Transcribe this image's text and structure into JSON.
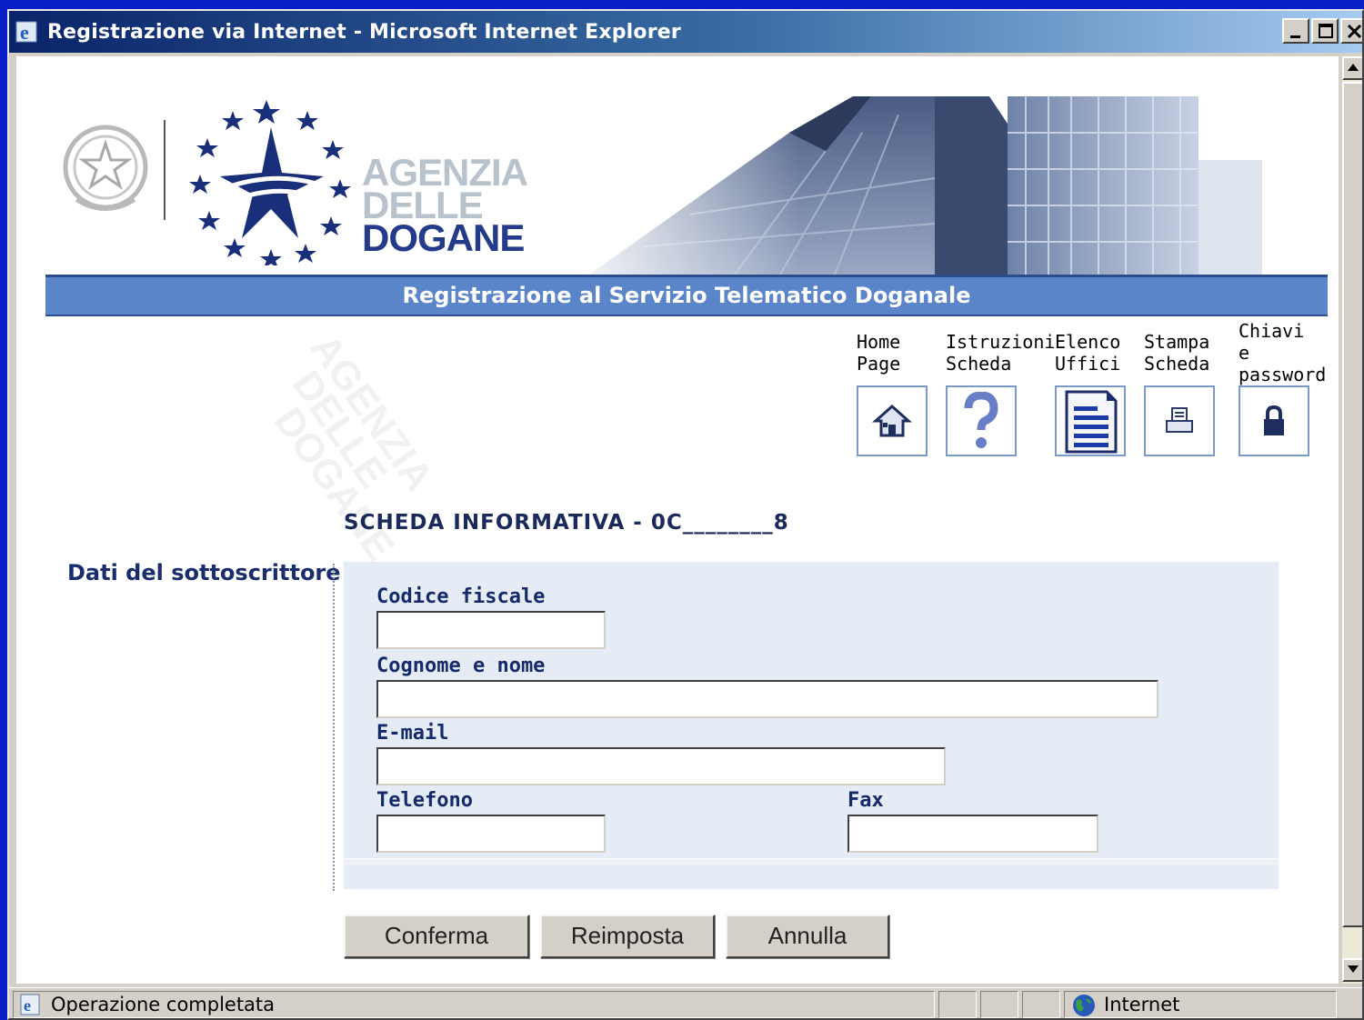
{
  "window": {
    "title": "Registrazione via Internet - Microsoft Internet Explorer"
  },
  "header": {
    "agency_line1": "AGENZIA",
    "agency_line2": "DELLE",
    "agency_line3": "DOGANE",
    "banner": "Registrazione al Servizio Telematico Doganale"
  },
  "nav": [
    {
      "label": "Home\nPage",
      "icon": "home-icon"
    },
    {
      "label": "Istruzioni\nScheda",
      "icon": "help-icon"
    },
    {
      "label": "Elenco\nUffici",
      "icon": "document-list-icon"
    },
    {
      "label": "Stampa\nScheda",
      "icon": "printer-icon"
    },
    {
      "label": "Chiavi\ne\npassword",
      "icon": "lock-icon"
    }
  ],
  "form": {
    "scheda_title": "SCHEDA INFORMATIVA - 0C________8",
    "section_title": "Dati del sottoscrittore",
    "fields": {
      "codice_fiscale": {
        "label": "Codice fiscale",
        "value": ""
      },
      "cognome_nome": {
        "label": "Cognome e nome",
        "value": ""
      },
      "email": {
        "label": "E-mail",
        "value": ""
      },
      "telefono": {
        "label": "Telefono",
        "value": ""
      },
      "fax": {
        "label": "Fax",
        "value": ""
      }
    },
    "buttons": {
      "confirm": "Conferma",
      "reset": "Reimposta",
      "cancel": "Annulla"
    }
  },
  "status": {
    "text": "Operazione completata",
    "zone": "Internet"
  },
  "colors": {
    "banner": "#5a85c8",
    "label_text": "#142a6a",
    "form_panel": "#e6ecf5",
    "titlebar_start": "#0a246a"
  }
}
